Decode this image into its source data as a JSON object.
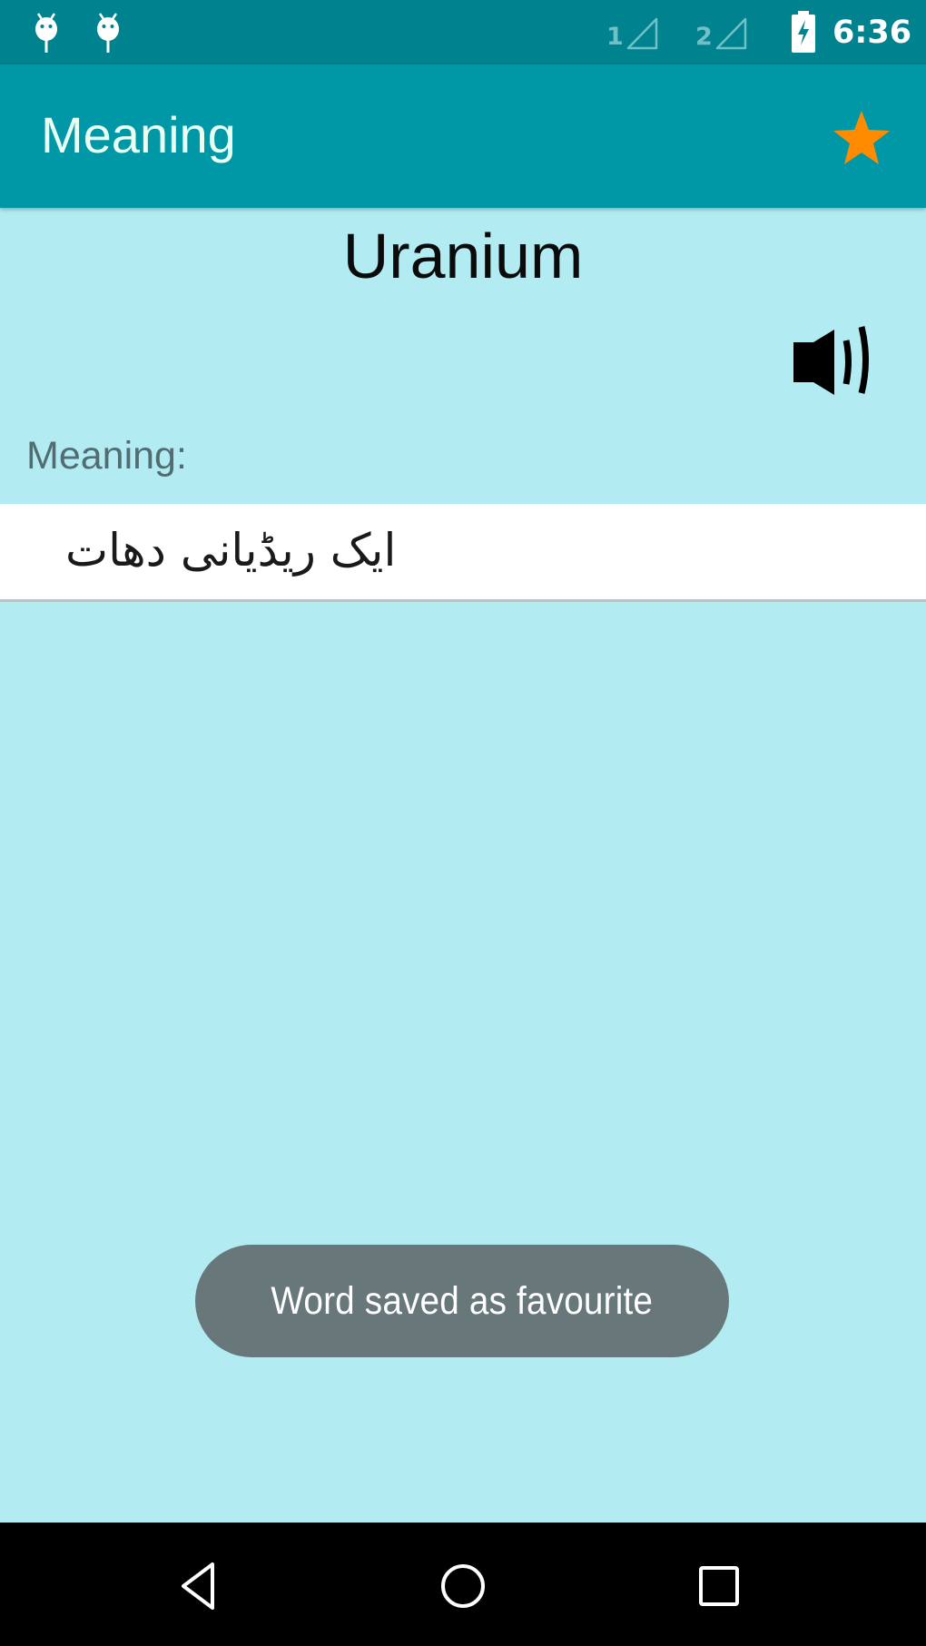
{
  "status_bar": {
    "notifications": [
      {
        "icon": "android-notification-icon"
      },
      {
        "icon": "android-notification-icon"
      }
    ],
    "sims": [
      {
        "label": "1",
        "icon": "signal-icon"
      },
      {
        "label": "2",
        "icon": "signal-icon"
      }
    ],
    "battery_icon": "battery-charging-icon",
    "time": "6:36"
  },
  "toolbar": {
    "title": "Meaning",
    "favourite_icon": "star-icon",
    "favourite_color": "#ff8c00"
  },
  "word": {
    "text": "Uranium",
    "speaker_icon": "speaker-icon"
  },
  "meaning": {
    "label": "Meaning:",
    "text": "ایک ریڈیانی دھات"
  },
  "toast": {
    "message": "Word saved as favourite"
  },
  "nav_bar": {
    "back_icon": "back-icon",
    "home_icon": "home-icon",
    "recents_icon": "recents-icon"
  },
  "colors": {
    "status_bar": "#00838f",
    "toolbar": "#0097a7",
    "background": "#b2ebf2",
    "toast": "#67777a"
  }
}
